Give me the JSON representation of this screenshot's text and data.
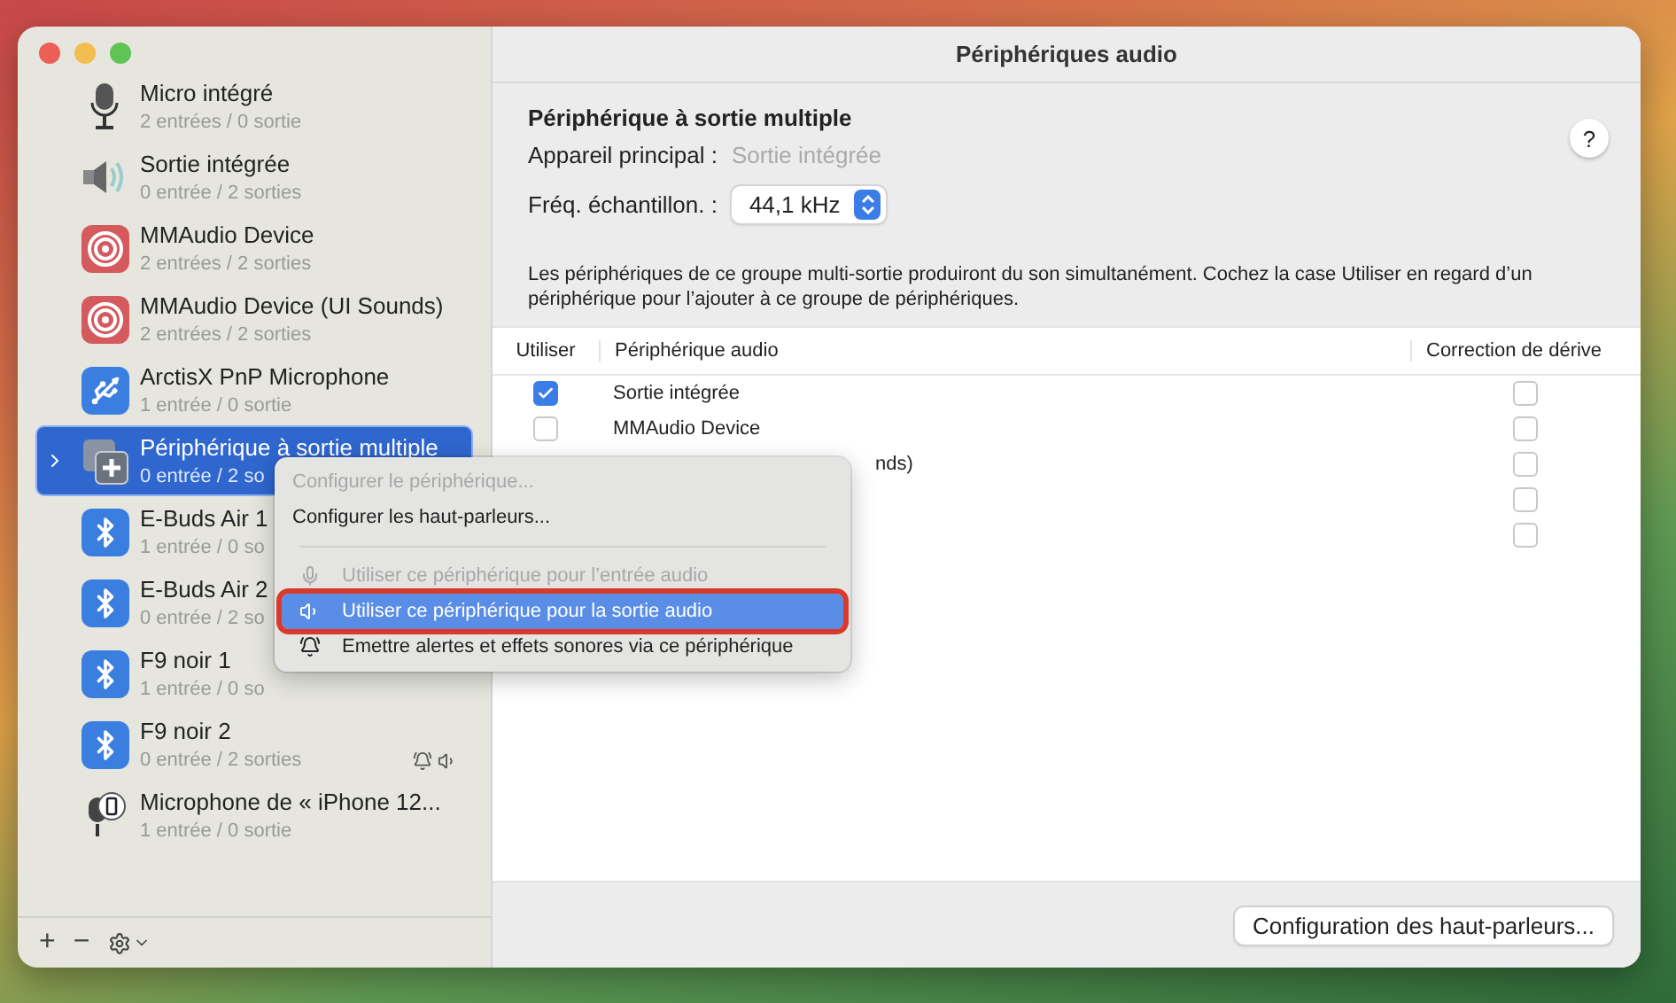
{
  "window": {
    "title": "Périphériques audio"
  },
  "sidebar": {
    "devices": [
      {
        "kind": "mic",
        "name": "Micro intégré",
        "channels": "2 entrées / 0 sortie",
        "selected": false
      },
      {
        "kind": "speaker",
        "name": "Sortie intégrée",
        "channels": "0 entrée / 2 sorties",
        "selected": false
      },
      {
        "kind": "mmaudio",
        "name": "MMAudio Device",
        "channels": "2 entrées / 2 sorties",
        "selected": false
      },
      {
        "kind": "mmaudio",
        "name": "MMAudio Device (UI Sounds)",
        "channels": "2 entrées / 2 sorties",
        "selected": false
      },
      {
        "kind": "usb",
        "name": "ArctisX PnP Microphone",
        "channels": "1 entrée / 0 sortie",
        "selected": false
      },
      {
        "kind": "aggregate",
        "name": "Périphérique à sortie multiple",
        "channels": "0 entrée / 2 so",
        "selected": true
      },
      {
        "kind": "bluetooth",
        "name": "E-Buds Air 1",
        "channels": "1 entrée / 0 so",
        "selected": false
      },
      {
        "kind": "bluetooth",
        "name": "E-Buds Air 2",
        "channels": "0 entrée / 2 so",
        "selected": false
      },
      {
        "kind": "bluetooth",
        "name": "F9  noir 1",
        "channels": "1 entrée / 0 so",
        "selected": false
      },
      {
        "kind": "bluetooth",
        "name": "F9  noir 2",
        "channels": "0 entrée / 2 sorties",
        "selected": false,
        "alert_sound": true,
        "default_output": true
      },
      {
        "kind": "iphone",
        "name": "Microphone de « iPhone 12...",
        "channels": "1 entrée / 0 sortie",
        "selected": false
      }
    ]
  },
  "detail": {
    "title": "Périphérique à sortie multiple",
    "help": "?",
    "main_label": "Appareil principal :",
    "main_value": "Sortie intégrée",
    "rate_label": "Fréq. échantillon. :",
    "rate_value": "44,1 kHz",
    "description": "Les périphériques de ce groupe multi-sortie produiront du son simultanément. Cochez la case Utiliser en regard d’un périphérique pour l’ajouter à ce groupe de périphériques.",
    "table": {
      "columns": [
        "Utiliser",
        "Périphérique audio",
        "Correction de dérive"
      ],
      "rows": [
        {
          "kind": "full",
          "use": true,
          "device": "Sortie intégrée",
          "drift": false
        },
        {
          "kind": "full",
          "use": false,
          "device": "MMAudio Device",
          "drift": false
        },
        {
          "kind": "covered",
          "device": "nds)",
          "drift": false
        },
        {
          "kind": "covered",
          "drift": false
        },
        {
          "kind": "covered",
          "drift": false
        }
      ]
    },
    "button": "Configuration des haut-parleurs..."
  },
  "context_menu": {
    "items": [
      {
        "kind": "plain",
        "label": "Configurer le périphérique...",
        "disabled": true,
        "selected": false
      },
      {
        "kind": "plain",
        "label": "Configurer les haut-parleurs...",
        "disabled": false,
        "selected": false
      },
      {
        "kind": "separator"
      },
      {
        "kind": "input",
        "label": "Utiliser ce périphérique pour l’entrée audio",
        "disabled": true,
        "selected": false
      },
      {
        "kind": "output",
        "label": "Utiliser ce périphérique pour la sortie audio",
        "disabled": false,
        "selected": true,
        "annotated": true
      },
      {
        "kind": "alerts",
        "label": "Emettre alertes et effets sonores via ce périphérique",
        "disabled": false,
        "selected": false
      }
    ]
  },
  "toolbar": {
    "add": "+",
    "remove": "−"
  }
}
